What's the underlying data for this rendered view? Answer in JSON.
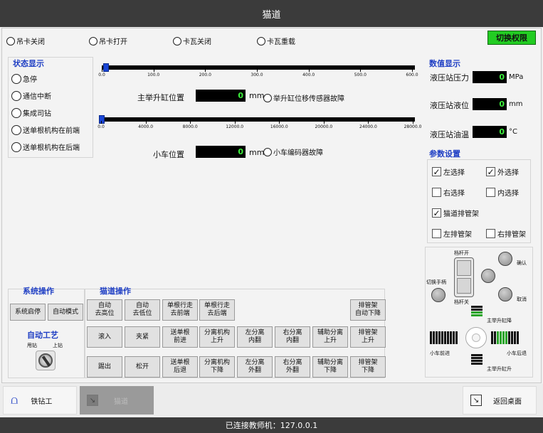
{
  "window": {
    "title": "猫道"
  },
  "top_radios": [
    {
      "label": "吊卡关闭"
    },
    {
      "label": "吊卡打开"
    },
    {
      "label": "卡瓦关闭"
    },
    {
      "label": "卡瓦重载"
    }
  ],
  "switch_button": {
    "label": "切换权限",
    "color": "#22cc22"
  },
  "status_display": {
    "title": "状态显示",
    "items": [
      {
        "label": "急停"
      },
      {
        "label": "通信中断"
      },
      {
        "label": "集成司钻"
      },
      {
        "label": "送单根机构在前端"
      },
      {
        "label": "送单根机构在后端"
      }
    ]
  },
  "lift_slider": {
    "ticks": [
      "0.0",
      "100.0",
      "200.0",
      "300.0",
      "400.0",
      "500.0",
      "600.0"
    ],
    "label": "主举升缸位置",
    "value": "0",
    "unit": "mm",
    "value_fraction": 0.01,
    "fault_label": "举升缸位移传感器故障"
  },
  "cart_slider": {
    "ticks": [
      "0.0",
      "4000.0",
      "8000.0",
      "12000.0",
      "16000.0",
      "20000.0",
      "24000.0",
      "28000.0"
    ],
    "label": "小车位置",
    "value": "0",
    "unit": "mm",
    "value_fraction": 0.0,
    "fault_label": "小车编码器故障"
  },
  "numeric_display": {
    "title": "数值显示",
    "items": [
      {
        "label": "液压站压力",
        "value": "0",
        "unit": "MPa"
      },
      {
        "label": "液压站液位",
        "value": "0",
        "unit": "mm"
      },
      {
        "label": "液压站油温",
        "value": "0",
        "unit": "°C"
      }
    ]
  },
  "params": {
    "title": "参数设置",
    "left_select": {
      "label": "左选择",
      "checked": "✓"
    },
    "outer_select": {
      "label": "外选择",
      "checked": "✓"
    },
    "right_select": {
      "label": "右选择",
      "checked": ""
    },
    "inner_select": {
      "label": "内选择",
      "checked": ""
    },
    "catwalk_rack": {
      "label": "猫道排管架",
      "checked": "✓"
    },
    "left_rack": {
      "label": "左排管架",
      "checked": ""
    },
    "right_rack": {
      "label": "右排管架",
      "checked": ""
    }
  },
  "joystick": {
    "lever_open": "档杆开",
    "lever_close": "档杆关",
    "switch_handle": "切换手柄",
    "confirm": "确认",
    "cancel": "取消",
    "lift_down": "主举升缸降",
    "lift_up": "主举升缸升",
    "cart_forward": "小车前进",
    "cart_back": "小车后退"
  },
  "system_ops": {
    "title": "系统操作",
    "start": "系统启停",
    "auto_mode": "自动模式",
    "auto_process": "自动工艺",
    "knob_left": "甩钻",
    "knob_right": "上钻"
  },
  "catwalk_ops": {
    "title": "猫道操作",
    "row1": [
      "自动\n去高位",
      "自动\n去低位",
      "单根行走\n去前端",
      "单根行走\n去后端",
      "排管架\n自动下降"
    ],
    "row2": [
      "滚入",
      "夹紧",
      "送单根\n前进",
      "分离机构\n上升",
      "左分离\n内翻",
      "右分离\n内翻",
      "辅助分离\n上升",
      "排管架\n上升"
    ],
    "row3": [
      "踢出",
      "松开",
      "送单根\n后退",
      "分离机构\n下降",
      "左分离\n外翻",
      "右分离\n外翻",
      "辅助分离\n下降",
      "排管架\n下降"
    ]
  },
  "bottom_nav": {
    "iron_roughneck": "铁钻工",
    "catwalk": "猫道",
    "home": "返回桌面"
  },
  "status_bar": {
    "text": "已连接教师机：127.0.0.1"
  }
}
